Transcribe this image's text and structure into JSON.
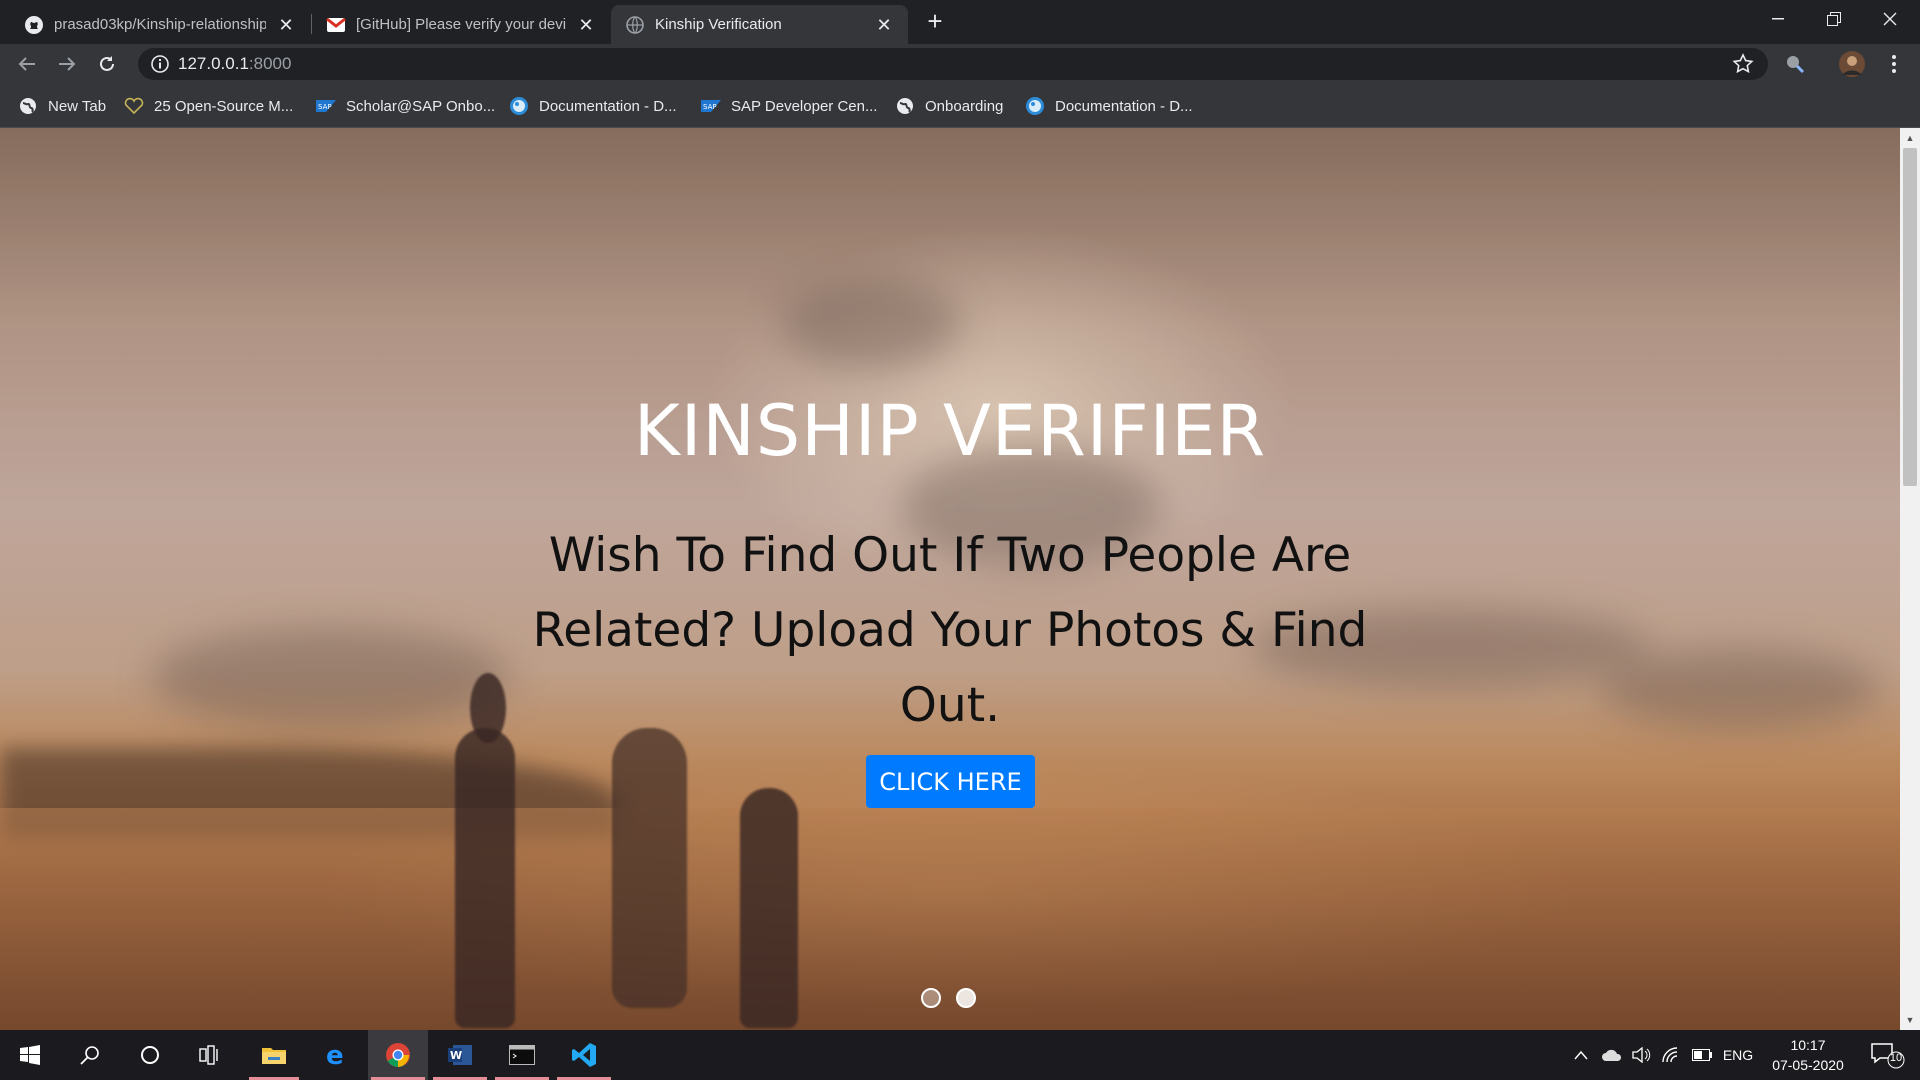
{
  "tabs": [
    {
      "title": "prasad03kp/Kinship-relationship",
      "icon": "github-icon"
    },
    {
      "title": "[GitHub] Please verify your device",
      "icon": "gmail-icon"
    },
    {
      "title": "Kinship Verification",
      "icon": "globe-icon",
      "active": true
    }
  ],
  "address": {
    "host": "127.0.0.1",
    "port": ":8000"
  },
  "bookmarks": [
    {
      "label": "New Tab",
      "icon": "globe-icon"
    },
    {
      "label": "25 Open-Source M...",
      "icon": "heart-icon"
    },
    {
      "label": "Scholar@SAP Onbo...",
      "icon": "sap-icon"
    },
    {
      "label": "Documentation - D...",
      "icon": "globe-blue-icon"
    },
    {
      "label": "SAP Developer Cen...",
      "icon": "sap-icon"
    },
    {
      "label": "Onboarding",
      "icon": "globe-icon"
    },
    {
      "label": "Documentation - D...",
      "icon": "globe-blue-icon"
    }
  ],
  "hero": {
    "title": "KINSHIP VERIFIER",
    "subtitle": "Wish To Find Out If Two People Are Related? Upload Your Photos & Find Out.",
    "cta": "CLICK HERE",
    "slides_total": 2,
    "active_slide": 2
  },
  "taskbar": {
    "apps": [
      "start-icon",
      "search-icon",
      "cortana-icon",
      "task-view-icon",
      "file-explorer-icon",
      "edge-icon",
      "chrome-icon",
      "word-icon",
      "terminal-icon",
      "vscode-icon"
    ],
    "lang": "ENG",
    "time": "10:17",
    "date": "07-05-2020",
    "notifications": "10"
  },
  "colors": {
    "accent": "#007bff",
    "chrome_dark": "#202124",
    "chrome_toolbar": "#35363a"
  }
}
